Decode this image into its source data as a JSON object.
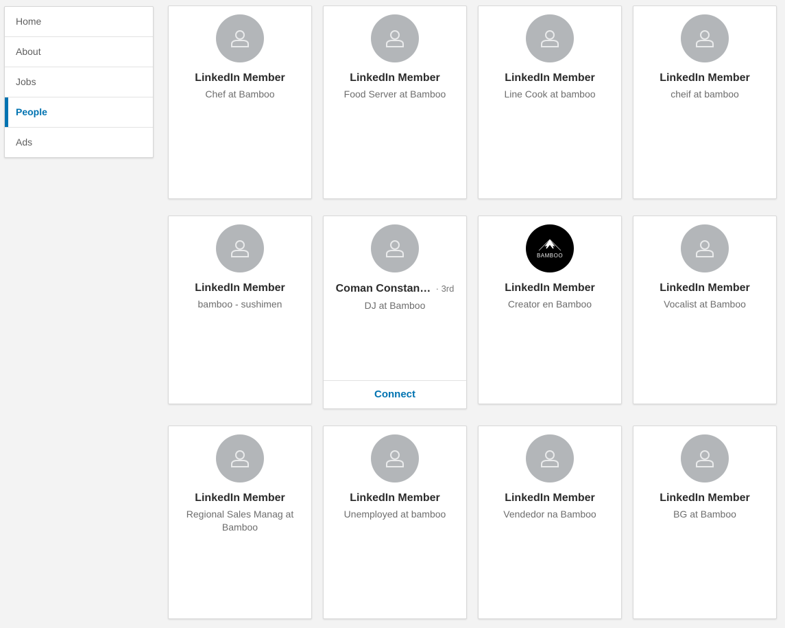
{
  "nav": {
    "items": [
      {
        "label": "Home"
      },
      {
        "label": "About"
      },
      {
        "label": "Jobs"
      },
      {
        "label": "People"
      },
      {
        "label": "Ads"
      }
    ]
  },
  "people": [
    {
      "name": "LinkedIn Member",
      "headline": "Chef at Bamboo",
      "avatar": "person-silhouette-icon"
    },
    {
      "name": "LinkedIn Member",
      "headline": "Food Server at Bamboo",
      "avatar": "person-silhouette-icon"
    },
    {
      "name": "LinkedIn Member",
      "headline": "Line Cook at bamboo",
      "avatar": "person-silhouette-icon"
    },
    {
      "name": "LinkedIn Member",
      "headline": "cheif at bamboo",
      "avatar": "person-silhouette-icon"
    },
    {
      "name": "LinkedIn Member",
      "headline": "bamboo - sushimen",
      "avatar": "person-silhouette-icon"
    },
    {
      "name": "Coman Constanti...",
      "degree": "· 3rd",
      "headline": "DJ at Bamboo",
      "avatar": "person-silhouette-icon",
      "action": "Connect"
    },
    {
      "name": "LinkedIn Member",
      "headline": "Creator en Bamboo",
      "avatar": "bamboo-logo",
      "logo_text": "BAMBOO"
    },
    {
      "name": "LinkedIn Member",
      "headline": "Vocalist at Bamboo",
      "avatar": "person-silhouette-icon"
    },
    {
      "name": "LinkedIn Member",
      "headline": "Regional Sales Manag at Bamboo",
      "avatar": "person-silhouette-icon"
    },
    {
      "name": "LinkedIn Member",
      "headline": "Unemployed at bamboo",
      "avatar": "person-silhouette-icon"
    },
    {
      "name": "LinkedIn Member",
      "headline": "Vendedor na Bamboo",
      "avatar": "person-silhouette-icon"
    },
    {
      "name": "LinkedIn Member",
      "headline": "BG at Bamboo",
      "avatar": "person-silhouette-icon"
    }
  ],
  "colors": {
    "accent": "#0073b1",
    "avatar_bg": "#b3b6b9",
    "page_bg": "#f3f3f3"
  }
}
